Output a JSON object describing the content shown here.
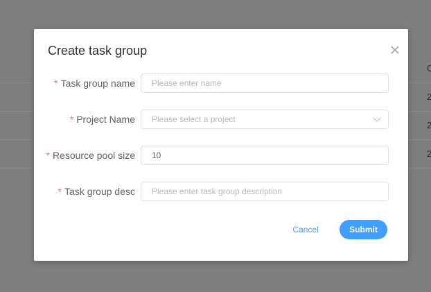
{
  "background": {
    "rows": [
      {
        "cell": "2"
      },
      {
        "cell": "2"
      },
      {
        "cell": "2"
      }
    ],
    "header_cell": "C"
  },
  "modal": {
    "title": "Create task group",
    "fields": [
      {
        "label": "Task group name",
        "placeholder": "Please enter name",
        "value": ""
      },
      {
        "label": "Project Name",
        "placeholder": "Please select a project",
        "value": ""
      },
      {
        "label": "Resource pool size",
        "placeholder": "",
        "value": "10"
      },
      {
        "label": "Task group desc",
        "placeholder": "Please enter task group description",
        "value": ""
      }
    ],
    "required_mark": "*",
    "cancel_label": "Cancel",
    "submit_label": "Submit"
  },
  "colors": {
    "accent": "#409eff",
    "required": "#f56c6c",
    "overlay": "#7f7f7f"
  },
  "icons": {
    "close": "close-icon",
    "dropdown": "chevron-down-icon"
  }
}
